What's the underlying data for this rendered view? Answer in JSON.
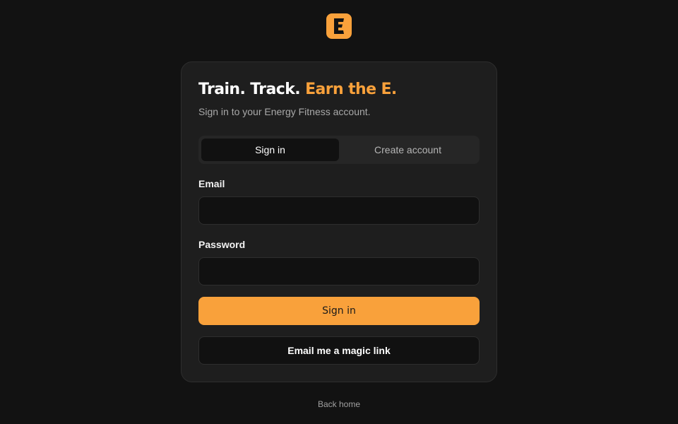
{
  "logo": {
    "icon": "energy-e-logo-icon",
    "color": "#f9a13b"
  },
  "card": {
    "headline": {
      "part1": "Train. Track. ",
      "accent": "Earn the E."
    },
    "subtitle": "Sign in to your Energy Fitness account."
  },
  "tabs": [
    {
      "label": "Sign in",
      "active": true
    },
    {
      "label": "Create account",
      "active": false
    }
  ],
  "form": {
    "email": {
      "label": "Email",
      "value": "",
      "placeholder": ""
    },
    "password": {
      "label": "Password",
      "value": "",
      "placeholder": ""
    }
  },
  "buttons": {
    "primary": "Sign in",
    "magic_link": "Email me a magic link"
  },
  "footer": {
    "back_link": "Back home"
  },
  "colors": {
    "accent": "#f9a13b",
    "background": "#121212",
    "card": "#1e1e1e"
  }
}
